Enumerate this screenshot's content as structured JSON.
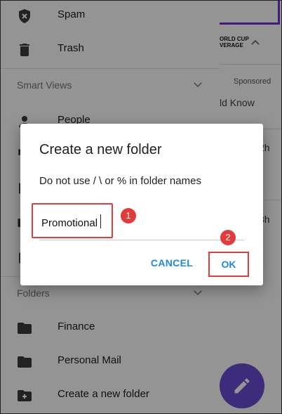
{
  "drawer": {
    "items_top": [
      {
        "label": "Spam",
        "icon": "shield-x-icon"
      },
      {
        "label": "Trash",
        "icon": "trash-icon"
      }
    ],
    "smart_views": {
      "label": "Smart Views",
      "items": [
        {
          "label": "People",
          "icon": "person-icon"
        }
      ]
    },
    "folders": {
      "label": "Folders",
      "items": [
        {
          "label": "Finance",
          "icon": "folder-icon"
        },
        {
          "label": "Personal Mail",
          "icon": "folder-icon"
        },
        {
          "label": "Create a new folder",
          "icon": "folder-plus-icon"
        }
      ]
    }
  },
  "background": {
    "ad_text_line1": "ORLD CUP",
    "ad_text_line2": "VERAGE",
    "sponsored": "Sponsored",
    "headline_fragment": "ld Know",
    "time_1": "2h",
    "time_2": "3h"
  },
  "dialog": {
    "title": "Create a new folder",
    "message": "Do not use / \\ or % in folder names",
    "input_value": "Promotional",
    "cancel_label": "CANCEL",
    "ok_label": "OK"
  },
  "annotations": {
    "step1": "1",
    "step2": "2"
  },
  "colors": {
    "accent": "#1e88e5",
    "highlight": "#e23b3b",
    "fab": "#6a4bd6",
    "scrim": "rgba(0,0,0,0.42)"
  }
}
